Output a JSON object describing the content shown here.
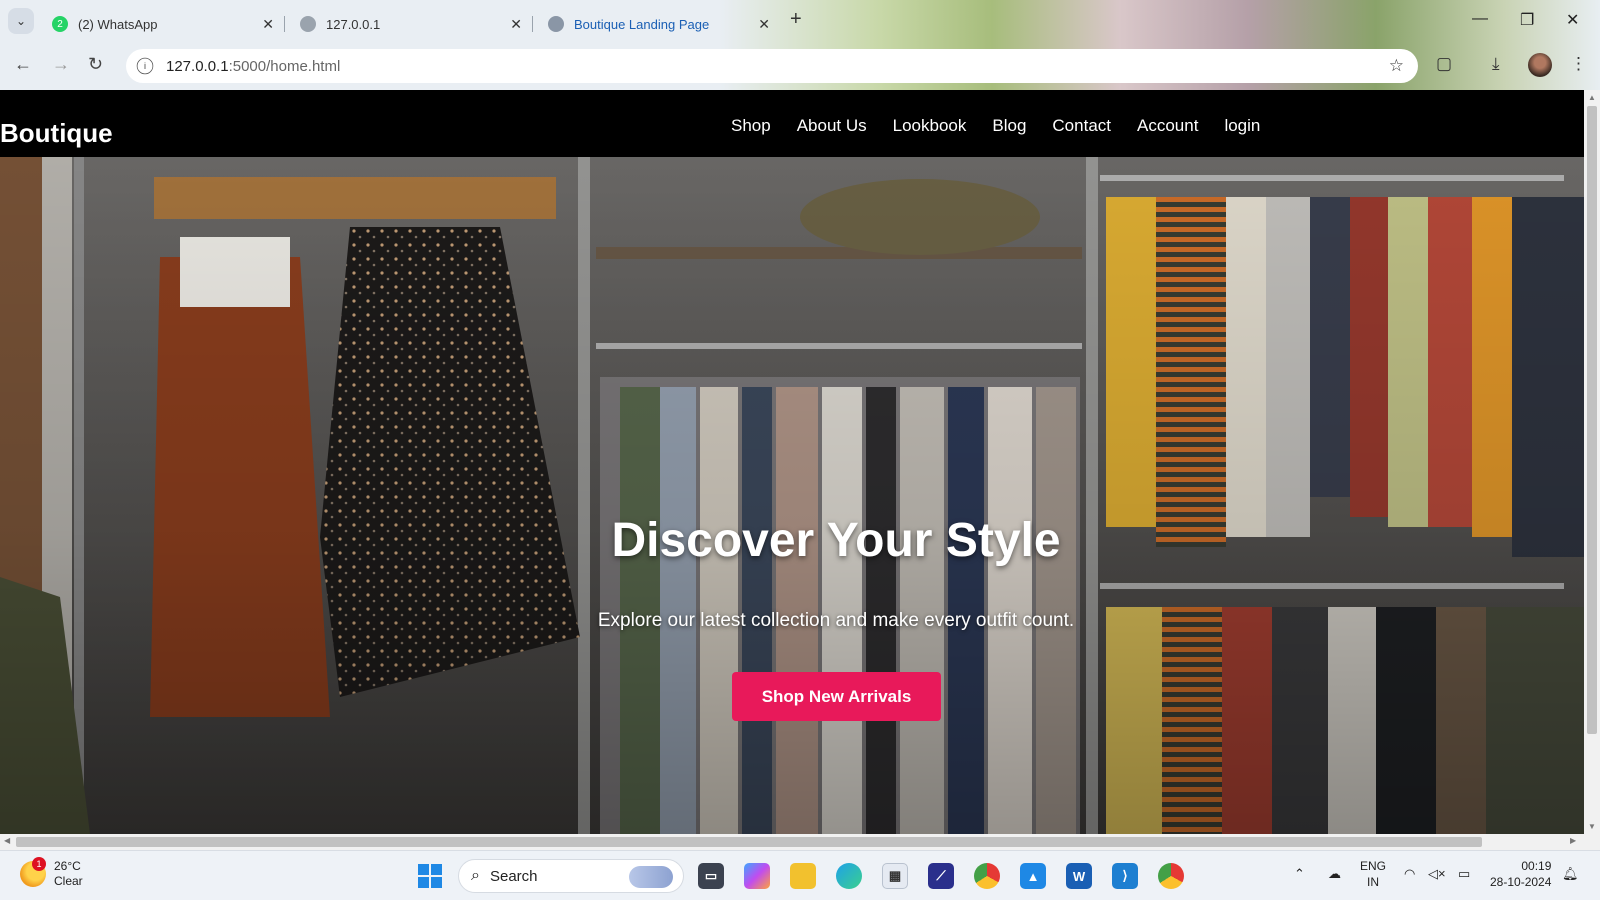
{
  "browser": {
    "tabs": [
      {
        "title": "(2) WhatsApp",
        "badge": "2"
      },
      {
        "title": "127.0.0.1"
      },
      {
        "title": "Boutique Landing Page"
      }
    ],
    "url_host": "127.0.0.1",
    "url_path": ":5000/home.html"
  },
  "site": {
    "brand": "Boutique",
    "menu": [
      "Shop",
      "About Us",
      "Lookbook",
      "Blog",
      "Contact",
      "Account",
      "login"
    ],
    "hero": {
      "title": "Discover Your Style",
      "subtitle": "Explore our latest collection and make every outfit count.",
      "cta": "Shop New Arrivals"
    },
    "accent_color": "#e8195a"
  },
  "taskbar": {
    "weather_temp": "26°C",
    "weather_desc": "Clear",
    "weather_badge": "1",
    "search_label": "Search",
    "lang_top": "ENG",
    "lang_bottom": "IN",
    "time": "00:19",
    "date": "28-10-2024"
  }
}
